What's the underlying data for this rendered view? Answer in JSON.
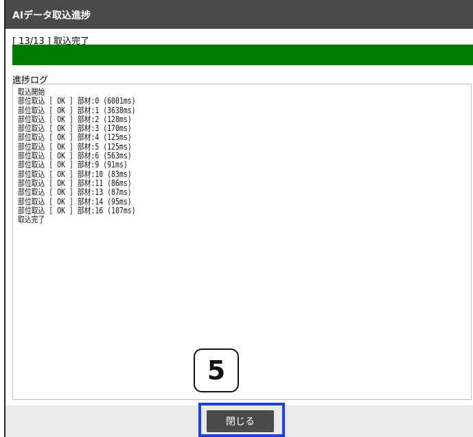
{
  "dialog": {
    "title": "AIデータ取込進捗",
    "status_text": "[ 13/13 ] 取込完了",
    "progress_percent": 100,
    "progress_color": "#007a00",
    "log_label": "進捗ログ",
    "log_lines": [
      "取込開始",
      "部位取込 [ OK ] 部材:0 (6001ms)",
      "部位取込 [ OK ] 部材:1 (3638ms)",
      "部位取込 [ OK ] 部材:2 (128ms)",
      "部位取込 [ OK ] 部材:3 (170ms)",
      "部位取込 [ OK ] 部材:4 (125ms)",
      "部位取込 [ OK ] 部材:5 (125ms)",
      "部位取込 [ OK ] 部材:6 (563ms)",
      "部位取込 [ OK ] 部材:9 (91ms)",
      "部位取込 [ OK ] 部材:10 (83ms)",
      "部位取込 [ OK ] 部材:11 (86ms)",
      "部位取込 [ OK ] 部材:13 (87ms)",
      "部位取込 [ OK ] 部材:14 (95ms)",
      "部位取込 [ OK ] 部材:16 (107ms)",
      "取込完了"
    ],
    "close_label": "閉じる"
  },
  "annotation": {
    "step_number": "5",
    "highlight_color": "#1c3fe0"
  }
}
